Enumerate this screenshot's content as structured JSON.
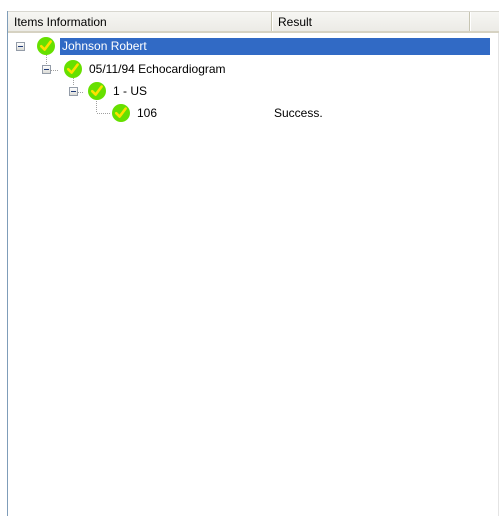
{
  "columns": {
    "items": "Items Information",
    "result": "Result"
  },
  "tree": {
    "patient": {
      "label": "Johnson Robert",
      "result": ""
    },
    "study": {
      "label": "05/11/94 Echocardiogram",
      "result": ""
    },
    "series": {
      "label": "1 - US",
      "result": ""
    },
    "image": {
      "label": "106",
      "result": "Success."
    }
  },
  "icons": {
    "status": "check-circle-icon",
    "expander": "collapse-minus-icon"
  },
  "colors": {
    "selection": "#316ac5",
    "check_fill": "#66e000",
    "check_mark": "#ffe000"
  }
}
